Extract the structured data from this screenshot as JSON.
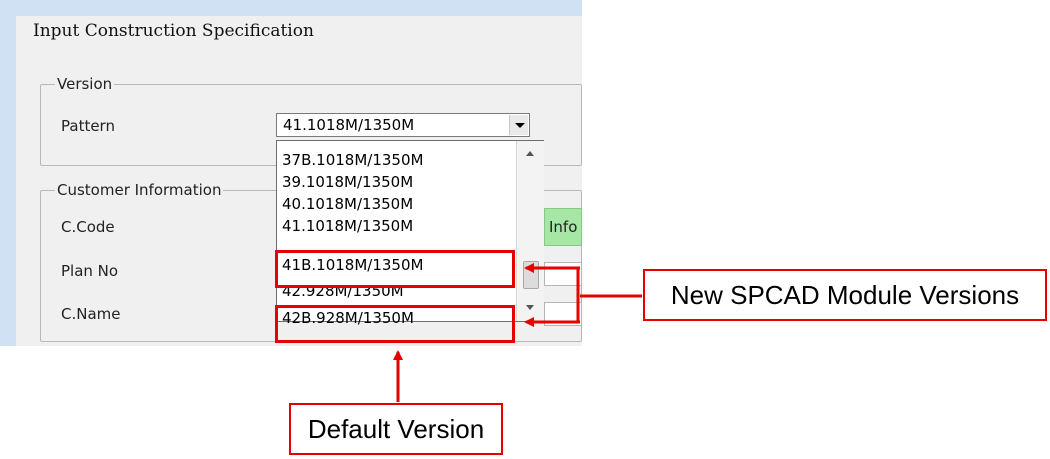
{
  "dialog": {
    "title": "Input Construction Specification",
    "version_group": {
      "legend": "Version",
      "pattern_label": "Pattern",
      "pattern_value": "41.1018M/1350M"
    },
    "customer_group": {
      "legend": "Customer Information",
      "fields": [
        "C.Code",
        "Plan No",
        "C.Name"
      ],
      "info_button_label": "Info"
    },
    "dropdown_options": [
      "37B.1018M/1350M",
      "39.1018M/1350M",
      "40.1018M/1350M",
      "41.1018M/1350M",
      "41B.1018M/1350M",
      "42.928M/1350M",
      "42B.928M/1350M"
    ]
  },
  "annotations": {
    "new_versions_label": "New SPCAD Module Versions",
    "default_version_label": "Default Version",
    "highlight_color": "#e60000"
  }
}
